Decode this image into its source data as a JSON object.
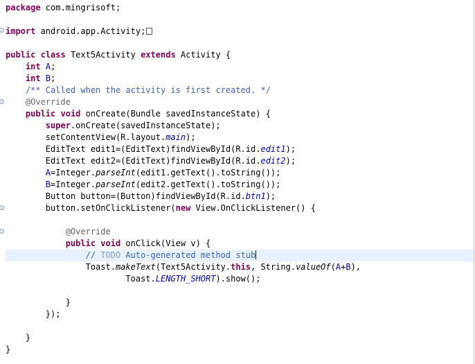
{
  "code": {
    "l1": [
      "package",
      " com.mingrisoft;"
    ],
    "l2": [
      "import",
      " android.app.Activity;"
    ],
    "l3": [
      "public",
      " ",
      "class",
      " Text5Activity ",
      "extends",
      " Activity {"
    ],
    "l4": [
      "int",
      "A",
      ";"
    ],
    "l5": [
      "int",
      "B",
      ";"
    ],
    "l6": [
      "/** Called when the activity is first created. */"
    ],
    "l7": [
      "@Override"
    ],
    "l8": [
      "public",
      "void",
      " onCreate(Bundle savedInstanceState) {"
    ],
    "l9": [
      "super",
      ".onCreate(savedInstanceState);"
    ],
    "l10": [
      "setContentView(R.layout.",
      "main",
      ");"
    ],
    "l11": [
      "EditText edit1=(EditText)findViewById(R.id.",
      "edit1",
      ");"
    ],
    "l12": [
      "EditText edit2=(EditText)findViewById(R.id.",
      "edit2",
      ");"
    ],
    "l13": [
      "A",
      "=Integer.",
      "parseInt",
      "(edit1.getText().toString());"
    ],
    "l14": [
      "B",
      "=Integer.",
      "parseInt",
      "(edit2.getText().toString());"
    ],
    "l15": [
      "Button button=(Button)findViewById(R.id.",
      "btn1",
      ");"
    ],
    "l16": [
      "button.setOnClickListener(",
      "new",
      " View.OnClickListener() {"
    ],
    "l17": [
      "@Override"
    ],
    "l18": [
      "public",
      "void",
      " onClick(View v) {"
    ],
    "l19": [
      "// ",
      "TODO",
      " Auto-generated method stub"
    ],
    "l20": [
      "Toast.",
      "makeText",
      "(Text5Activity.",
      "this",
      ", String.",
      "valueOf",
      "(",
      "A",
      "+",
      "B",
      "),"
    ],
    "l21": [
      "Toast.",
      "LENGTH_SHORT",
      ").show();"
    ],
    "l22": [
      "}"
    ],
    "l23": [
      "});"
    ],
    "l24": [
      "}"
    ],
    "l25": [
      "}"
    ]
  },
  "colors": {
    "keyword": "#7f0055",
    "comment": "#3f5fbf",
    "task_tag": "#7f9fbf",
    "annotation": "#646464",
    "field": "#0000c0",
    "current_line": "#e8f2fe"
  },
  "icons": {
    "import_fold": "fold-expand-icon",
    "method_fold": "fold-collapse-icon",
    "collapsed_import": "collapsed-block-icon"
  }
}
